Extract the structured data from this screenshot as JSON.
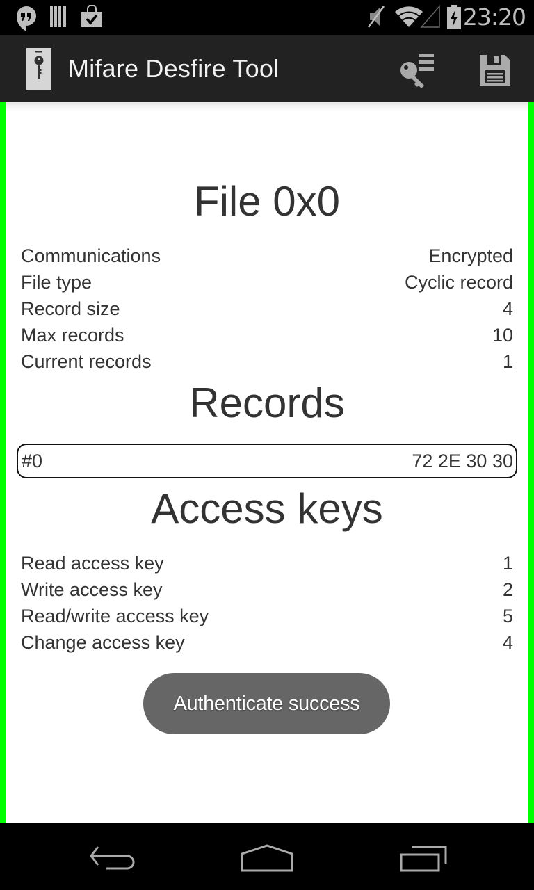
{
  "status_bar": {
    "time": "23:20",
    "left_icons": [
      "hangouts-icon",
      "barcode-icon",
      "play-store-bag-icon"
    ],
    "right_icons": [
      "muted-speaker-icon",
      "wifi-icon",
      "cell-signal-icon",
      "battery-charging-icon"
    ]
  },
  "action_bar": {
    "title": "Mifare Desfire Tool",
    "app_icon": "key-card-icon",
    "actions": [
      {
        "name": "keys-list",
        "icon": "key-list-icon"
      },
      {
        "name": "save",
        "icon": "floppy-save-icon"
      }
    ]
  },
  "file": {
    "heading": "File 0x0",
    "properties": [
      {
        "label": "Communications",
        "value": "Encrypted"
      },
      {
        "label": "File type",
        "value": "Cyclic record"
      },
      {
        "label": "Record size",
        "value": "4"
      },
      {
        "label": "Max records",
        "value": "10"
      },
      {
        "label": "Current records",
        "value": "1"
      }
    ]
  },
  "records": {
    "heading": "Records",
    "items": [
      {
        "index": "#0",
        "data": "72 2E 30 30"
      }
    ]
  },
  "access_keys": {
    "heading": "Access keys",
    "items": [
      {
        "label": "Read access key",
        "value": "1"
      },
      {
        "label": "Write access key",
        "value": "2"
      },
      {
        "label": "Read/write access key",
        "value": "5"
      },
      {
        "label": "Change access key",
        "value": "4"
      }
    ]
  },
  "toast": {
    "message": "Authenticate success"
  },
  "nav_bar": {
    "buttons": [
      "back",
      "home",
      "recents"
    ]
  },
  "colors": {
    "frame_border": "#00ff00",
    "action_bar_bg": "#222222",
    "toast_bg": "#666666",
    "text": "#333333"
  }
}
